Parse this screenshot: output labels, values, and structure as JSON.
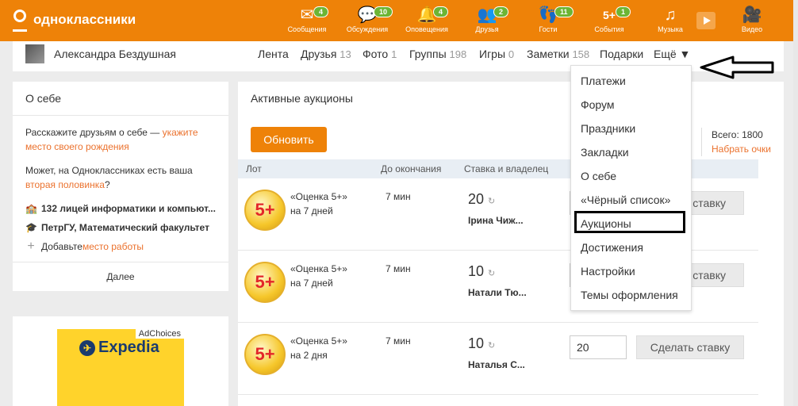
{
  "header": {
    "logo_text": "одноклассники",
    "nav": [
      {
        "label": "Сообщения",
        "badge": "4",
        "icon": "envelope-icon"
      },
      {
        "label": "Обсуждения",
        "badge": "10",
        "icon": "chat-bubbles-icon"
      },
      {
        "label": "Оповещения",
        "badge": "4",
        "icon": "bell-icon"
      },
      {
        "label": "Друзья",
        "badge": "2",
        "icon": "people-icon"
      },
      {
        "label": "Гости",
        "badge": "11",
        "icon": "footprints-icon"
      },
      {
        "label": "События",
        "badge": "1",
        "icon": "five-plus-icon"
      },
      {
        "label": "Музыка",
        "badge": "",
        "icon": "music-note-icon"
      },
      {
        "label": "Видео",
        "badge": "",
        "icon": "video-camera-icon"
      }
    ],
    "colors": {
      "brand": "#ee8208",
      "badge": "#6cb534"
    }
  },
  "profile": {
    "name": "Александра Бездушная",
    "menu": [
      {
        "label": "Лента",
        "count": ""
      },
      {
        "label": "Друзья",
        "count": "13"
      },
      {
        "label": "Фото",
        "count": "1"
      },
      {
        "label": "Группы",
        "count": "198"
      },
      {
        "label": "Игры",
        "count": "0"
      },
      {
        "label": "Заметки",
        "count": "158"
      },
      {
        "label": "Подарки",
        "count": ""
      },
      {
        "label": "Ещё ▼",
        "count": ""
      }
    ]
  },
  "about": {
    "title": "О себе",
    "line1_text": "Расскажите друзьям о себе — ",
    "line1_link": "укажите место своего рождения",
    "line2_text": "Может, на Одноклассниках есть ваша ",
    "line2_link": "вторая половинка",
    "line2_end": "?",
    "school": "132 лицей информатики и компьют...",
    "university": "ПетрГУ, Математический факультет",
    "work_prefix": "Добавьте ",
    "work_link": "место работы",
    "more": "Далее"
  },
  "ad": {
    "choices": "AdChoices",
    "brand": "Expedia"
  },
  "auctions": {
    "title": "Активные аукционы",
    "refresh": "Обновить",
    "total_label": "Всего: 1800",
    "earn_link": "Набрать очки",
    "columns": {
      "lot": "Лот",
      "ends": "До окончания",
      "bid": "Ставка и владелец"
    },
    "medal": "5+",
    "rows": [
      {
        "name": "«Оценка 5+»",
        "duration": "на 7 дней",
        "time": "7 мин",
        "bid": "20",
        "owner": "Ірина Чиж...",
        "input": "",
        "button": "ь ставку"
      },
      {
        "name": "«Оценка 5+»",
        "duration": "на 7 дней",
        "time": "7 мин",
        "bid": "10",
        "owner": "Натали Тю...",
        "input": "",
        "button": "ь ставку"
      },
      {
        "name": "«Оценка 5+»",
        "duration": "на 2 дня",
        "time": "7 мин",
        "bid": "10",
        "owner": "Наталья С...",
        "input": "20",
        "button": "Сделать ставку"
      }
    ]
  },
  "dropdown": {
    "items": [
      "Платежи",
      "Форум",
      "Праздники",
      "Закладки",
      "О себе",
      "«Чёрный список»",
      "Аукционы",
      "Достижения",
      "Настройки",
      "Темы оформления"
    ],
    "highlighted": "Аукционы"
  }
}
